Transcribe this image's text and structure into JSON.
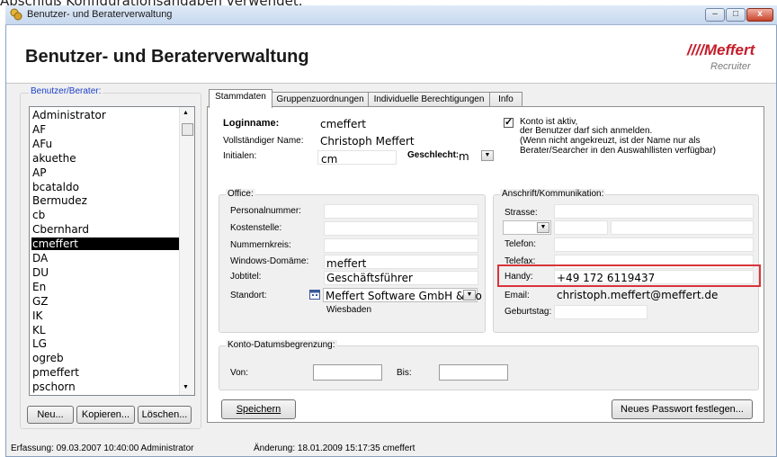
{
  "top_caption": "Abschluß Konfigurationsangaben verwendet.",
  "window": {
    "title": "Benutzer- und Beraterverwaltung",
    "controls": {
      "minimize": "–",
      "maximize": "□",
      "close": "x"
    }
  },
  "header": {
    "title": "Benutzer- und Beraterverwaltung",
    "logo": "////Meffert",
    "logo_sub": "Recruiter"
  },
  "users_group": {
    "label": "Benutzer/Berater:",
    "items": [
      "Administrator",
      "AF",
      "AFu",
      "akuethe",
      "AP",
      "bcataldo",
      "Bermudez",
      "cb",
      "Cbernhard",
      "cmeffert",
      "DA",
      "DU",
      "En",
      "GZ",
      "IK",
      "KL",
      "LG",
      "ogreb",
      "pmeffert",
      "pschorn"
    ],
    "selected": "cmeffert",
    "buttons": {
      "new": "Neu...",
      "copy": "Kopieren...",
      "delete": "Löschen..."
    }
  },
  "tabs": [
    "Stammdaten",
    "Gruppenzuordnungen",
    "Individuelle Berechtigungen",
    "Info"
  ],
  "stammdaten": {
    "loginname_label": "Loginname:",
    "loginname": "cmeffert",
    "fullname_label": "Vollständiger Name:",
    "fullname": "Christoph Meffert",
    "initials_label": "Initialen:",
    "initials": "cm",
    "gender_label": "Geschlecht:",
    "gender": "m",
    "active_checkbox": "Konto ist aktiv,",
    "active_line2": "der Benutzer darf sich anmelden.",
    "active_line3": "(Wenn nicht angekreuzt, ist der Name nur als",
    "active_line4": "Berater/Searcher in den Auswahllisten verfügbar)",
    "active_checked": true
  },
  "office": {
    "label": "Office:",
    "personalnummer_label": "Personalnummer:",
    "kostenstelle_label": "Kostenstelle:",
    "nummernkreis_label": "Nummernkreis:",
    "domain_label": "Windows-Domäme:",
    "domain": "meffert",
    "jobtitle_label": "Jobtitel:",
    "jobtitle": "Geschäftsführer",
    "standort_label": "Standort:",
    "standort": "Meffert Software GmbH & Co",
    "standort_city": "Wiesbaden"
  },
  "contact": {
    "label": "Anschrift/Kommunikation:",
    "strasse_label": "Strasse:",
    "telefon_label": "Telefon:",
    "telefax_label": "Telefax:",
    "handy_label": "Handy:",
    "handy": "+49 172 6119437",
    "email_label": "Email:",
    "email": "christoph.meffert@meffert.de",
    "geburtstag_label": "Geburtstag:"
  },
  "date_limit": {
    "label": "Konto-Datumsbegrenzung:",
    "from_label": "Von:",
    "to_label": "Bis:"
  },
  "actions": {
    "save": "Speichern",
    "new_password": "Neues Passwort festlegen..."
  },
  "status": {
    "created": "Erfassung: 09.03.2007 10:40:00  Administrator",
    "changed": "Änderung: 18.01.2009 15:17:35  cmeffert"
  },
  "colors": {
    "accent_red": "#d9343a",
    "logo_red": "#c31d2a",
    "selection": "#000000"
  }
}
